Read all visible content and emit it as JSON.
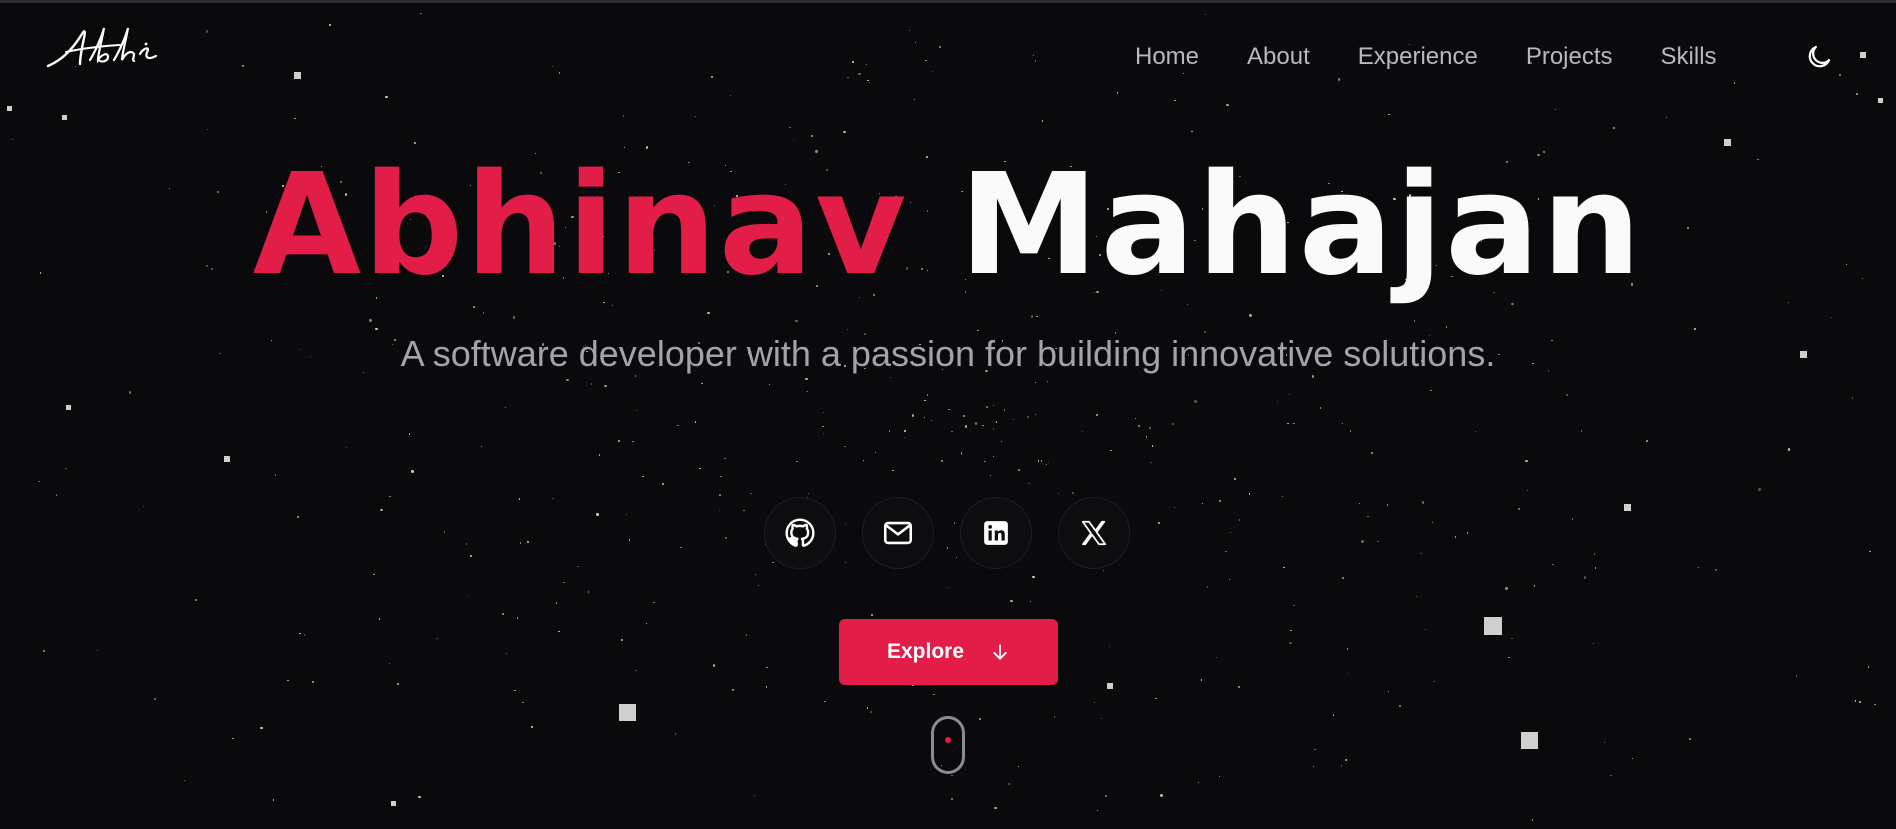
{
  "header": {
    "logo_text": "Abhi",
    "nav": [
      {
        "label": "Home"
      },
      {
        "label": "About"
      },
      {
        "label": "Experience"
      },
      {
        "label": "Projects"
      },
      {
        "label": "Skills"
      }
    ],
    "theme_toggle_icon": "moon-icon"
  },
  "hero": {
    "first_name": "Abhinav",
    "last_name": "Mahajan",
    "tagline": "A software developer with a passion for building innovative solutions.",
    "socials": [
      {
        "icon": "github-icon"
      },
      {
        "icon": "mail-icon"
      },
      {
        "icon": "linkedin-icon"
      },
      {
        "icon": "x-twitter-icon"
      }
    ],
    "explore_label": "Explore",
    "explore_icon": "arrow-down-icon",
    "scroll_indicator_icon": "mouse-scroll-icon"
  },
  "colors": {
    "background": "#0a0a0c",
    "accent": "#e11d48",
    "text_primary": "#fafafa",
    "text_muted": "#a3a3ab"
  }
}
